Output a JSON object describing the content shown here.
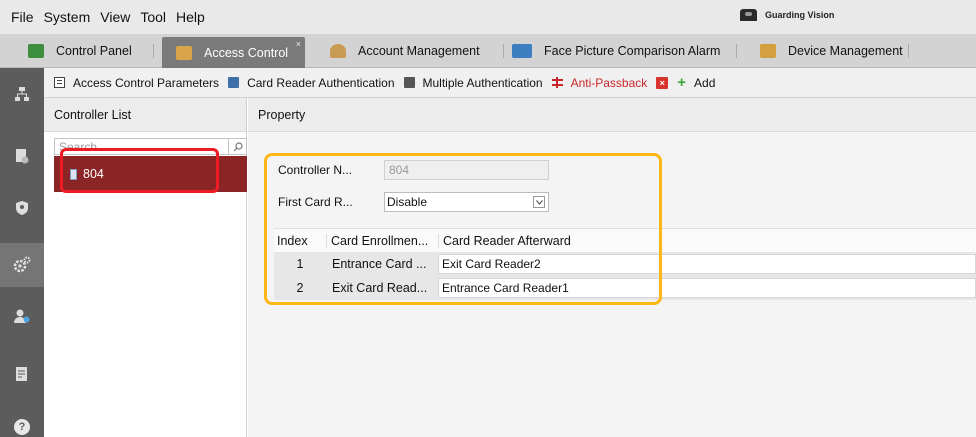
{
  "menubar": {
    "items": [
      "File",
      "System",
      "View",
      "Tool",
      "Help"
    ],
    "brand": "Guarding Vision"
  },
  "module_tabs": [
    {
      "label": "Control Panel",
      "icon": "control-panel-icon",
      "color": "#3b8e3b"
    },
    {
      "label": "Access Control",
      "icon": "access-control-icon",
      "color": "#d9a54a",
      "active": true,
      "close": "×"
    },
    {
      "label": "Account Management",
      "icon": "account-icon",
      "color": "#c99b55"
    },
    {
      "label": "Face Picture Comparison Alarm",
      "icon": "face-alarm-icon",
      "color": "#3c7fc1"
    },
    {
      "label": "Device Management",
      "icon": "device-icon",
      "color": "#d3a040"
    }
  ],
  "sidebar": {
    "icons": [
      "device-tree-icon",
      "card-icon",
      "shield-icon",
      "gear-icon",
      "person-icon",
      "report-icon",
      "help-icon"
    ],
    "help_glyph": "?"
  },
  "sub_tabs": [
    {
      "label": "Access Control Parameters",
      "icon": "parameters-icon"
    },
    {
      "label": "Card Reader Authentication",
      "icon": "card-reader-icon"
    },
    {
      "label": "Multiple Authentication",
      "icon": "multi-auth-icon"
    },
    {
      "label": "Anti-Passback",
      "icon": "anti-passback-icon",
      "active": true,
      "close": "×"
    },
    {
      "label": "Add",
      "icon": "add-icon",
      "glyph": "+"
    }
  ],
  "controller_list": {
    "title": "Controller List",
    "search_placeholder": "Search...",
    "items": [
      {
        "label": "804",
        "selected": true
      }
    ]
  },
  "property": {
    "title": "Property",
    "controller_name_label": "Controller N...",
    "controller_name_value": "804",
    "first_card_label": "First Card R...",
    "first_card_value": "Disable",
    "table": {
      "columns": [
        "Index",
        "Card Enrollmen...",
        "Card Reader Afterward"
      ],
      "rows": [
        {
          "index": "1",
          "enrollment": "Entrance Card ...",
          "afterward": "Exit Card Reader2"
        },
        {
          "index": "2",
          "enrollment": "Exit Card Read...",
          "afterward": "Entrance Card Reader1"
        }
      ]
    }
  },
  "colors": {
    "accent_red": "#c8282d",
    "selected_row": "#8b2424",
    "highlight_red": "#ee1c24",
    "highlight_orange": "#fdb717",
    "sidebar": "#5c5c5c"
  }
}
